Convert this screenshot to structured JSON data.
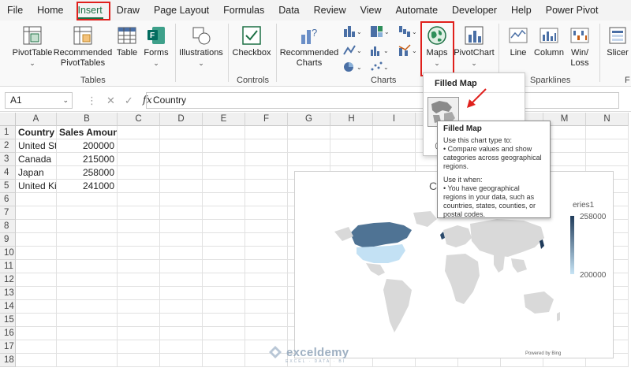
{
  "menu": {
    "items": [
      "File",
      "Home",
      "Insert",
      "Draw",
      "Page Layout",
      "Formulas",
      "Data",
      "Review",
      "View",
      "Automate",
      "Developer",
      "Help",
      "Power Pivot"
    ],
    "active_index": 2
  },
  "ribbon": {
    "buttons": {
      "pivottable": "PivotTable",
      "recommended_pivottables_1": "Recommended",
      "recommended_pivottables_2": "PivotTables",
      "table": "Table",
      "forms": "Forms",
      "illustrations": "Illustrations",
      "checkbox": "Checkbox",
      "recommended_charts_1": "Recommended",
      "recommended_charts_2": "Charts",
      "maps": "Maps",
      "pivotchart": "PivotChart",
      "line": "Line",
      "column": "Column",
      "winloss_1": "Win/",
      "winloss_2": "Loss",
      "slicer": "Slicer"
    },
    "groups": {
      "tables": "Tables",
      "controls": "Controls",
      "charts": "Charts",
      "sparklines": "Sparklines",
      "filters_partial": "F"
    }
  },
  "formula_bar": {
    "name_box": "A1",
    "fx": "fx",
    "content": "Country"
  },
  "sheet": {
    "columns": [
      "A",
      "B",
      "C",
      "D",
      "E",
      "F",
      "G",
      "H",
      "I",
      "J",
      "K",
      "L",
      "M",
      "N"
    ],
    "rows": [
      "1",
      "2",
      "3",
      "4",
      "5",
      "6",
      "7",
      "8",
      "9",
      "10",
      "11",
      "12",
      "13",
      "14",
      "15",
      "16",
      "17",
      "18"
    ],
    "headers": [
      "Country",
      "Sales Amount"
    ],
    "data": [
      {
        "country": "United States",
        "sales": "200000"
      },
      {
        "country": "Canada",
        "sales": "215000"
      },
      {
        "country": "Japan",
        "sales": "258000"
      },
      {
        "country": "United Kingdom",
        "sales": "241000"
      }
    ]
  },
  "chart": {
    "title_partial": "C",
    "legend_title_partial": "eries1",
    "legend_max": "258000",
    "legend_min": "200000",
    "powered_by": "Powered by Bing",
    "colors": {
      "high": "#1f3b5a",
      "low": "#c7e4f5",
      "land": "#d9d9d9"
    }
  },
  "maps_dropdown": {
    "header": "Filled Map",
    "partial_icon": "@"
  },
  "tooltip": {
    "title": "Filled Map",
    "p1": "Use this chart type to:",
    "p1_b1": "• Compare values and show categories across geographical regions.",
    "p2": "Use it when:",
    "p2_b1": "• You have geographical regions in your data, such as countries, states, counties, or postal codes."
  },
  "watermark": {
    "name": "exceldemy",
    "tagline": "EXCEL · DATA · BI"
  },
  "accent": "#1e7145",
  "highlight": "#e0201c"
}
